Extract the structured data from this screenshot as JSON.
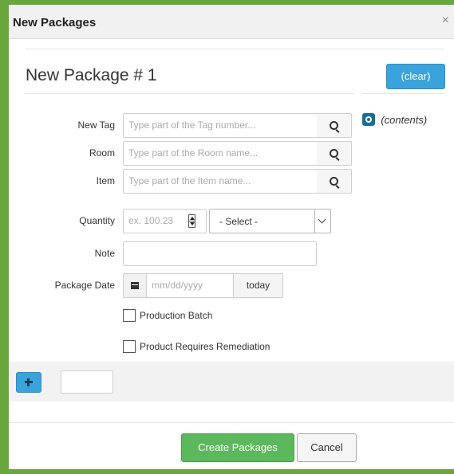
{
  "dialog": {
    "title": "New Packages",
    "close_glyph": "×"
  },
  "package": {
    "heading": "New Package # 1",
    "clear_label": "(clear)",
    "contents_label": "(contents)"
  },
  "fields": {
    "new_tag": {
      "label": "New Tag",
      "placeholder": "Type part of the Tag number..."
    },
    "room": {
      "label": "Room",
      "placeholder": "Type part of the Room name..."
    },
    "item": {
      "label": "Item",
      "placeholder": "Type part of the Item name..."
    },
    "quantity": {
      "label": "Quantity",
      "placeholder": "ex. 100.23",
      "unit_selected": "- Select -"
    },
    "note": {
      "label": "Note",
      "value": ""
    },
    "package_date": {
      "label": "Package Date",
      "placeholder": "mm/dd/yyyy",
      "today_label": "today"
    }
  },
  "checkboxes": {
    "production_batch": {
      "label": "Production Batch",
      "checked": false
    },
    "requires_remediation": {
      "label": "Product Requires Remediation",
      "checked": false
    }
  },
  "footer": {
    "count_value": ""
  },
  "actions": {
    "create_label": "Create Packages",
    "cancel_label": "Cancel"
  },
  "colors": {
    "frame": "#6aa63e",
    "primary": "#3aa3db",
    "success": "#5cb85c",
    "contents_icon": "#1a6e93"
  },
  "icons": {
    "search": "search-icon",
    "calendar": "calendar-icon",
    "add": "plus-icon",
    "contents": "add-circle-icon",
    "close": "close-icon",
    "dropdown": "chevron-down-icon",
    "spinner": "spinner-icon"
  }
}
